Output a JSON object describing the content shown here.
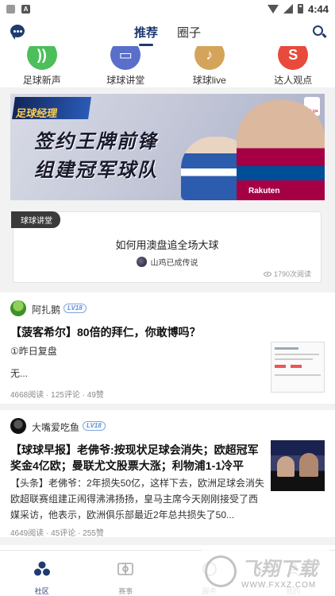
{
  "status_bar": {
    "time": "4:44",
    "notification_badge": "A"
  },
  "top_nav": {
    "tabs": [
      {
        "label": "推荐",
        "active": true
      },
      {
        "label": "圈子",
        "active": false
      }
    ],
    "icons": {
      "left": "chat-icon",
      "right": "search-icon"
    }
  },
  "quick_links": [
    {
      "label": "足球新声",
      "icon": "wifi-broadcast-icon",
      "color": "#4cbf5a"
    },
    {
      "label": "球球讲堂",
      "icon": "classroom-icon",
      "color": "#5a6fc9"
    },
    {
      "label": "球球live",
      "icon": "music-note-icon",
      "color": "#d4a45a"
    },
    {
      "label": "达人观点",
      "icon": "s-icon",
      "color": "#e84a3c"
    }
  ],
  "banner": {
    "logo_text": "足球经理",
    "headline_line1": "签约王牌前锋",
    "headline_line2": "组建冠军球队",
    "league_badge": "LaLiga",
    "sponsor": "Rakuten"
  },
  "course_card": {
    "badge": "球球讲堂",
    "title": "如何用澳盘追全场大球",
    "author": "山鸡已成传说",
    "views": "1790次阅读"
  },
  "posts": [
    {
      "username": "阿扎鹅",
      "level": "LV18",
      "title": "【菠客希尔】80倍的拜仁，你敢博吗？",
      "body_line1": "①昨日复盘",
      "body_line2": "无...",
      "stats": "4668阅读 · 125评论 · 49赞"
    },
    {
      "username": "大嘴爱吃鱼",
      "level": "LV18",
      "title_line1": "【球球早报】老佛爷:按现状足球会消失；欧超冠军",
      "title_line2": "奖金4亿欧；曼联尤文股票大涨；利物浦1-1冷平",
      "body_line1": "【头条】老佛爷：2年损失50亿，这样下去，欧洲足球会消失",
      "body_line2": "欧超联赛组建正闹得沸沸扬扬，皇马主席今天刚刚接受了西",
      "body_line3": "媒采访，他表示，欧洲俱乐部最近2年总共损失了50...",
      "stats": "4649阅读 · 45评论 · 255赞"
    }
  ],
  "tab_bar": [
    {
      "label": "社区",
      "active": true
    },
    {
      "label": "赛事",
      "active": false
    },
    {
      "label": "服务",
      "active": false
    },
    {
      "label": "我的",
      "active": false
    }
  ],
  "watermark": {
    "main": "飞翔下载",
    "sub": "WWW.FXXZ.COM"
  },
  "colors": {
    "brand": "#1f3b70",
    "level_badge": "#5b8fd6"
  }
}
